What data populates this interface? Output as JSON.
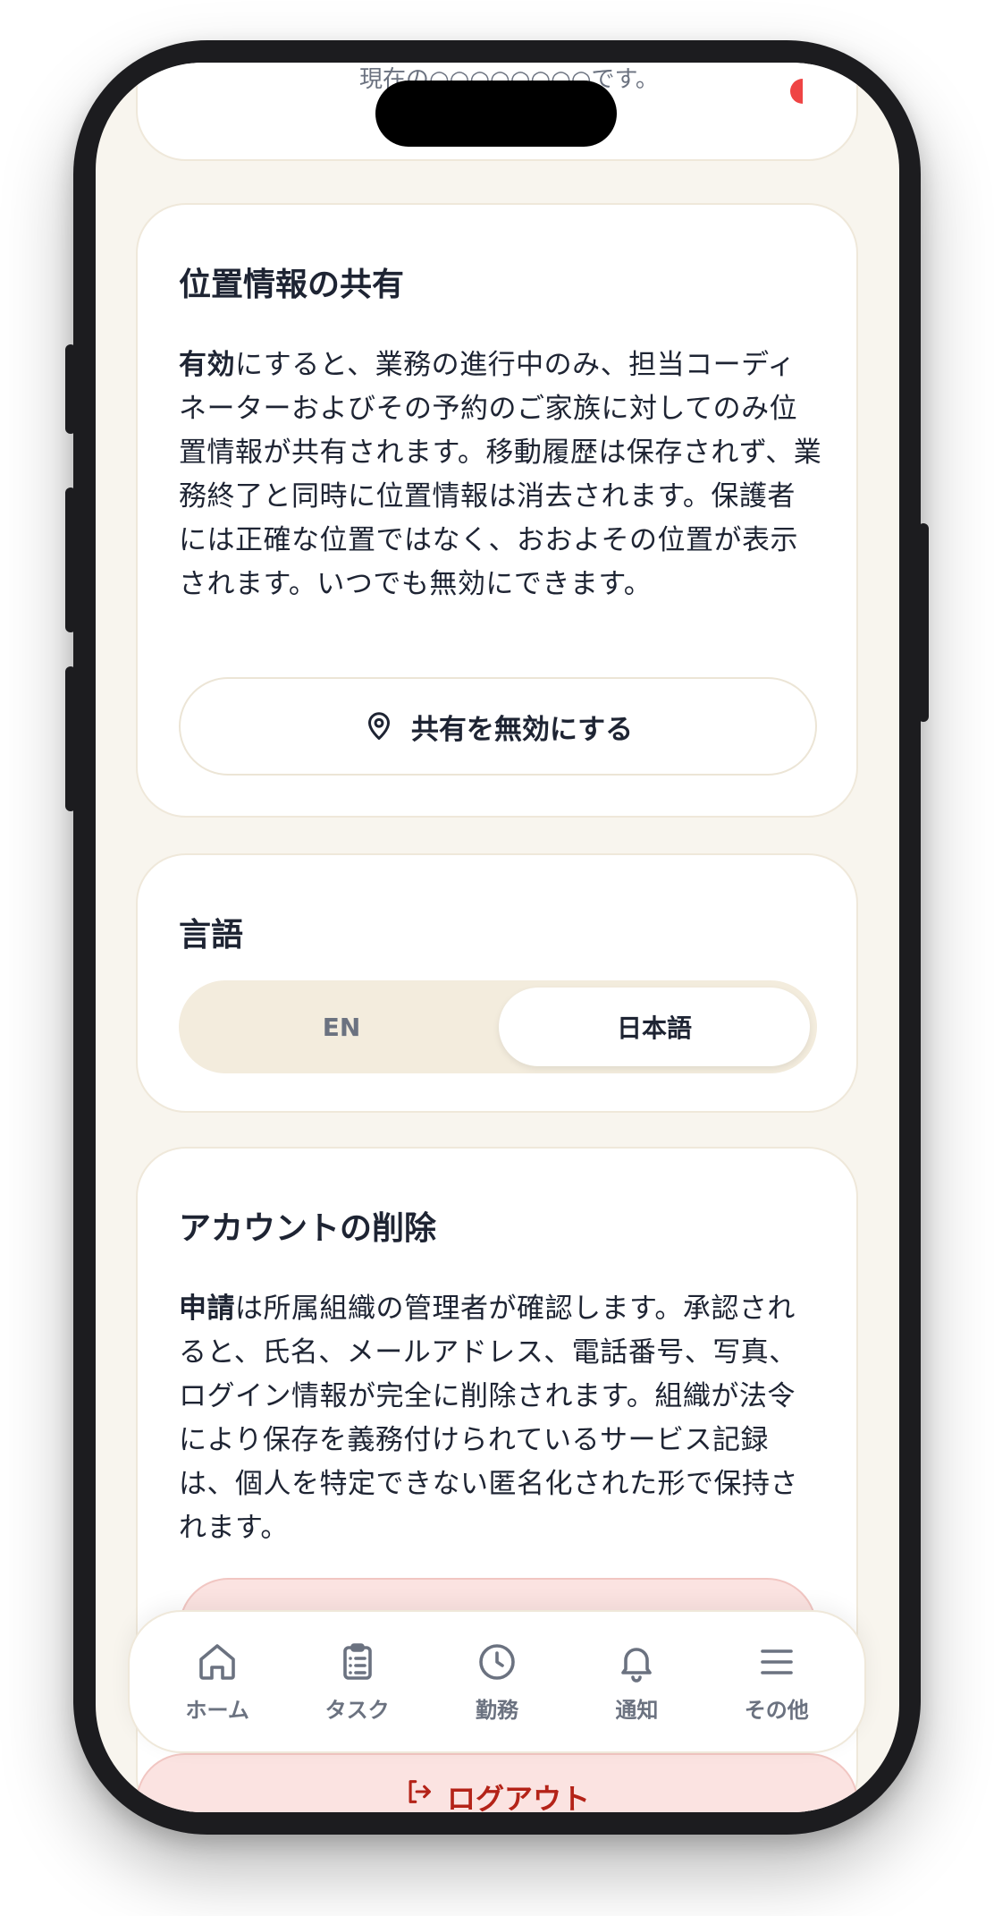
{
  "top_card": {
    "status_text": "現在の○○○○○○○○です。"
  },
  "location": {
    "title": "位置情報の共有",
    "body_lead": "有効",
    "body_rest": "にすると、業務の進行中のみ、担当コーディネーターおよびその予約のご家族に対してのみ位置情報が共有されます。移動履歴は保存されず、業務終了と同時に位置情報は消去されます。保護者には正確な位置ではなく、おおよその位置が表示されます。いつでも無効にできます。",
    "button_label": "共有を無効にする",
    "button_icon": "map-pin-icon"
  },
  "language": {
    "title": "言語",
    "options": [
      "EN",
      "日本語"
    ],
    "selected": "日本語"
  },
  "account_delete": {
    "title": "アカウントの削除",
    "body_lead": "申請",
    "body_rest": "は所属組織の管理者が確認します。承認されると、氏名、メールアドレス、電話番号、写真、ログイン情報が完全に削除されます。組織が法令により保存を義務付けられているサービス記録は、個人を特定できない匿名化された形で保持されます。"
  },
  "logout": {
    "label": "ログアウト",
    "icon": "logout-icon"
  },
  "nav": {
    "items": [
      {
        "label": "ホーム",
        "icon": "home-icon"
      },
      {
        "label": "タスク",
        "icon": "clipboard-icon"
      },
      {
        "label": "勤務",
        "icon": "clock-icon"
      },
      {
        "label": "通知",
        "icon": "bell-icon"
      },
      {
        "label": "その他",
        "icon": "menu-icon"
      }
    ]
  },
  "colors": {
    "background": "#f8f5ee",
    "text": "#1e2433",
    "muted": "#6b7280",
    "danger": "#b42318",
    "danger_bg": "#fbe3e1"
  }
}
